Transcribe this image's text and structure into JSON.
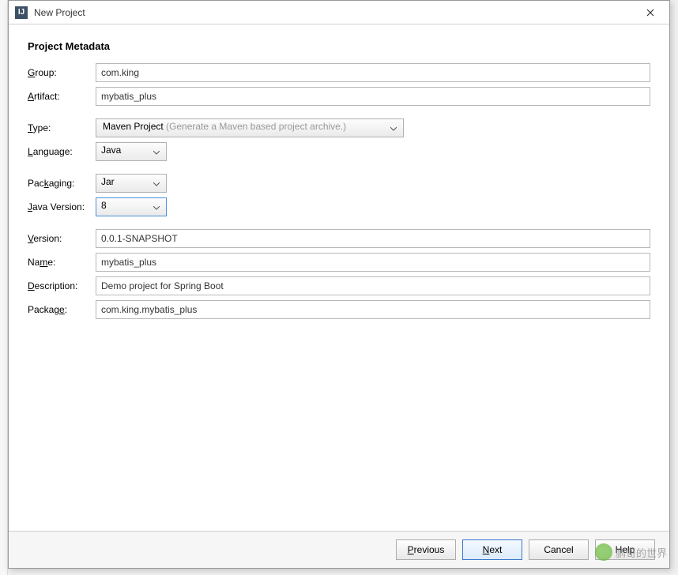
{
  "window": {
    "title": "New Project",
    "icon_letter": "IJ"
  },
  "section_title": "Project Metadata",
  "labels": {
    "group": "Group:",
    "artifact": "Artifact:",
    "type": "Type:",
    "language": "Language:",
    "packaging": "Packaging:",
    "java_version": "Java Version:",
    "version": "Version:",
    "name": "Name:",
    "description": "Description:",
    "package": "Package:"
  },
  "fields": {
    "group": "com.king",
    "artifact": "mybatis_plus",
    "type_value": "Maven Project",
    "type_hint": "(Generate a Maven based project archive.)",
    "language": "Java",
    "packaging": "Jar",
    "java_version": "8",
    "version": "0.0.1-SNAPSHOT",
    "name": "mybatis_plus",
    "description": "Demo project for Spring Boot",
    "package": "com.king.mybatis_plus"
  },
  "buttons": {
    "previous": "Previous",
    "next": "Next",
    "cancel": "Cancel",
    "help": "Help"
  },
  "watermark": "鹏哥的世界"
}
